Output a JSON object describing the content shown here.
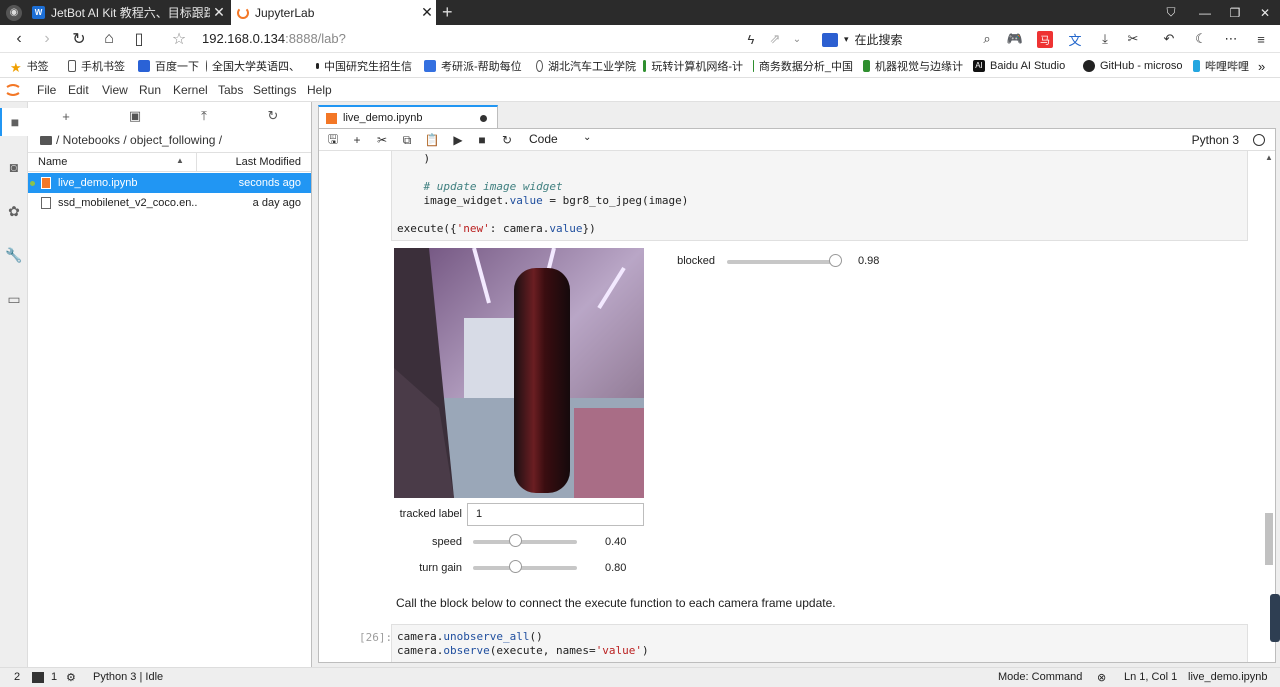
{
  "browser": {
    "tabs": [
      {
        "title": "JetBot AI Kit 教程六、目标跟踪 - W",
        "favicon": "W"
      },
      {
        "title": "JupyterLab"
      }
    ],
    "url_host": "192.168.0.134",
    "url_rest": ":8888/lab?",
    "search_placeholder": "在此搜索",
    "bookmarks": [
      "书签",
      "手机书签",
      "百度一下",
      "全国大学英语四、",
      "中国研究生招生信",
      "考研派-帮助每位",
      "湖北汽车工业学院",
      "玩转计算机网络-计",
      "商务数据分析_中国",
      "机器视觉与边缘计",
      "Baidu AI Studio",
      "GitHub - microso",
      "哔哩哔哩"
    ]
  },
  "menu": [
    "File",
    "Edit",
    "View",
    "Run",
    "Kernel",
    "Tabs",
    "Settings",
    "Help"
  ],
  "filebrowser": {
    "breadcrumb": "/ Notebooks / object_following /",
    "col_name": "Name",
    "col_modified": "Last Modified",
    "files": [
      {
        "name": "live_demo.ipynb",
        "modified": "seconds ago"
      },
      {
        "name": "ssd_mobilenet_v2_coco.en...",
        "modified": "a day ago"
      }
    ]
  },
  "notebook": {
    "tab_title": "live_demo.ipynb",
    "cell_type": "Code",
    "kernel": "Python 3",
    "code1": {
      "l1": "    )",
      "l3": "    # update image widget",
      "l4a": "    image_widget.",
      "l4b": "value",
      "l4c": " = bgr8_to_jpeg(image)",
      "l6a": "execute({",
      "l6b": "'new'",
      "l6c": ": camera.",
      "l6d": "value",
      "l6e": "})"
    },
    "widgets": {
      "blocked_label": "blocked",
      "blocked_value": "0.98",
      "blocked_frac": 0.98,
      "tracked_label": "tracked label",
      "tracked_value": "1",
      "speed_label": "speed",
      "speed_value": "0.40",
      "speed_frac": 0.4,
      "turn_label": "turn gain",
      "turn_value": "0.80",
      "turn_frac": 0.4
    },
    "markdown": "Call the block below to connect the execute function to each camera frame update.",
    "prompt2": "[26]:",
    "code2": {
      "l1a": "camera.",
      "l1b": "unobserve_all",
      "l1c": "()",
      "l2a": "camera.",
      "l2b": "observe",
      "l2c": "(execute, names=",
      "l2d": "'value'",
      "l2e": ")"
    }
  },
  "statusbar": {
    "left_num": "2",
    "term_count": "1",
    "kernel_status": "Python 3 | Idle",
    "mode": "Mode: Command",
    "position": "Ln 1, Col 1",
    "file": "live_demo.ipynb"
  },
  "colors": {
    "accent": "#2196f3",
    "jupyter_orange": "#f37726"
  }
}
